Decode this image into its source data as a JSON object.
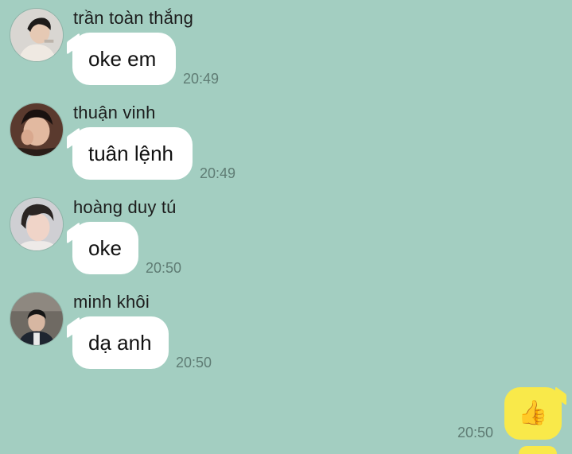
{
  "messages": [
    {
      "sender": "trần toàn thắng",
      "text": "oke em",
      "time": "20:49"
    },
    {
      "sender": "thuận vinh",
      "text": "tuân lệnh",
      "time": "20:49"
    },
    {
      "sender": "hoàng duy tú",
      "text": "oke",
      "time": "20:50"
    },
    {
      "sender": "minh khôi",
      "text": "dạ anh",
      "time": "20:50"
    }
  ],
  "outgoing": {
    "emoji": "👍",
    "time": "20:50"
  },
  "colors": {
    "background": "#a3cec1",
    "incoming_bubble": "#ffffff",
    "outgoing_bubble": "#f9e94a",
    "timestamp": "#5f7c74"
  }
}
